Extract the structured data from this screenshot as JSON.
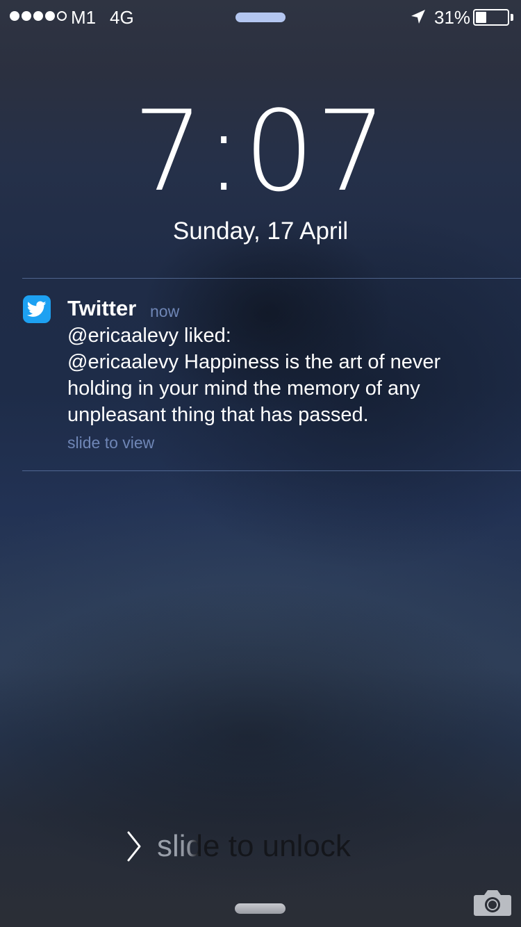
{
  "status_bar": {
    "signal_bars_filled": 4,
    "signal_bars_total": 5,
    "carrier": "M1",
    "network": "4G",
    "location_icon": "location-arrow-icon",
    "battery_percent": "31%",
    "battery_level": 0.31
  },
  "lock_screen": {
    "time": "7:07",
    "date": "Sunday, 17 April"
  },
  "notification": {
    "app_icon": "twitter-bird-icon",
    "app_name": "Twitter",
    "time": "now",
    "lines": [
      "@ericaalevy liked:",
      "@ericaalevy Happiness is the art of never",
      "holding in your mind the memory of any",
      "unpleasant thing that has passed."
    ],
    "action_hint": "slide to view"
  },
  "unlock": {
    "chevron_icon": "chevron-right-icon",
    "label": "slide to unlock"
  },
  "camera": {
    "icon": "camera-icon"
  },
  "colors": {
    "twitter_blue": "#1da1f2",
    "secondary_text": "#6f86b6",
    "divider": "#5a78a8"
  }
}
